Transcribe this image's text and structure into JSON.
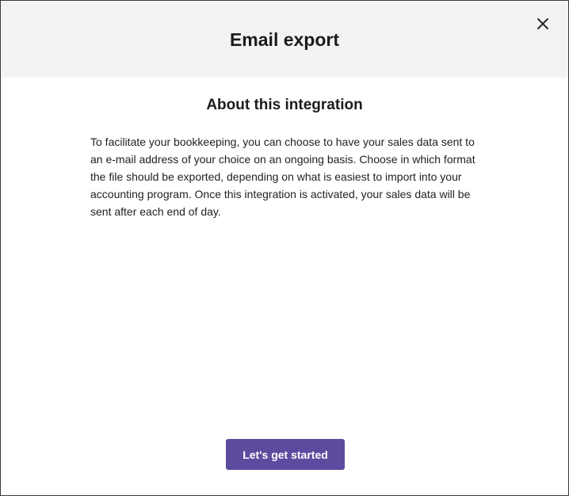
{
  "modal": {
    "title": "Email export",
    "close_icon": "close-icon"
  },
  "content": {
    "heading": "About this integration",
    "description": "To facilitate your bookkeeping, you can choose to have your sales data sent to an e-mail address of your choice on an ongoing basis. Choose in which format the file should be exported, depending on what is easiest to import into your accounting program. Once this integration is activated, your sales data will be sent after each end of day."
  },
  "actions": {
    "start_label": "Let's get started"
  },
  "colors": {
    "header_background": "#f2f3f5",
    "primary_button": "#5c4b9e"
  }
}
